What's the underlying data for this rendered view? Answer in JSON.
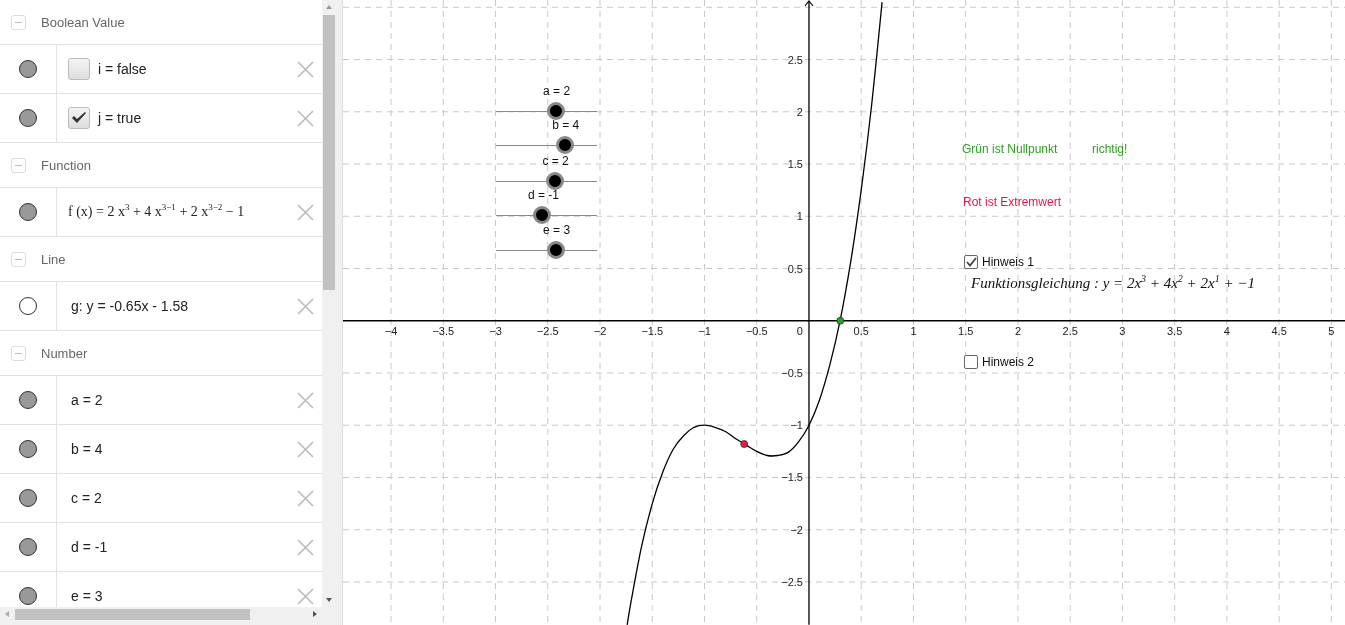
{
  "algebra": {
    "sections": [
      {
        "title": "Boolean Value",
        "expanded": true,
        "items": [
          {
            "kind": "boolean",
            "visible": true,
            "checked": false,
            "text": "i = false"
          },
          {
            "kind": "boolean",
            "visible": true,
            "checked": true,
            "text": "j = true"
          }
        ]
      },
      {
        "title": "Function",
        "expanded": true,
        "items": [
          {
            "kind": "formula",
            "visible": true,
            "text": "f (x) = 2 x$^{3}$ + 4 x$^{3−1}$ + 2 x$^{3−2}$ − 1"
          }
        ]
      },
      {
        "title": "Line",
        "expanded": true,
        "items": [
          {
            "kind": "value",
            "visible": false,
            "text": "g: y = -0.65x - 1.58"
          }
        ]
      },
      {
        "title": "Number",
        "expanded": true,
        "items": [
          {
            "kind": "value",
            "visible": true,
            "text": "a = 2"
          },
          {
            "kind": "value",
            "visible": true,
            "text": "b = 4"
          },
          {
            "kind": "value",
            "visible": true,
            "text": "c = 2"
          },
          {
            "kind": "value",
            "visible": true,
            "text": "d = -1"
          },
          {
            "kind": "value",
            "visible": true,
            "text": "e = 3"
          }
        ]
      }
    ]
  },
  "graphics": {
    "sliders": [
      {
        "label": "a = 2",
        "level": 0.59
      },
      {
        "label": "b = 4",
        "level": 0.68
      },
      {
        "label": "c = 2",
        "level": 0.58
      },
      {
        "label": "d = -1",
        "level": 0.46
      },
      {
        "label": "e = 3",
        "level": 0.59
      }
    ],
    "texts": [
      {
        "text": "Grün ist Nullpunkt",
        "color": "#2e9e22"
      },
      {
        "text": "richtig!",
        "color": "#2e9e22"
      },
      {
        "text": "Rot ist Extremwert",
        "color": "#e8164a"
      }
    ],
    "checkboxes": [
      {
        "label": "Hinweis 1",
        "checked": true
      },
      {
        "label": "Hinweis 2",
        "checked": false
      }
    ],
    "formula": "Funktionsgleichung : y = 2x$^{3}$ + 4x$^{2}$ + 2x$^{1}$ + −1",
    "origin_label": "0",
    "points": [
      {
        "color": "#2aa02a"
      },
      {
        "color": "#e8164a"
      }
    ],
    "chart_data": {
      "type": "line",
      "grid": true,
      "xlim": [
        -4.46,
        5.14
      ],
      "ylim": [
        -2.91,
        3.07
      ],
      "x": [
        -1.74,
        -1.7,
        -1.6,
        -1.5,
        -1.4,
        -1.3,
        -1.2,
        -1.1,
        -1.0,
        -0.9,
        -0.8,
        -0.7,
        -0.6,
        -0.5,
        -0.4,
        -0.3,
        -0.2,
        -0.1,
        0,
        0.1,
        0.2,
        0.3,
        0.4,
        0.5,
        0.6,
        0.7
      ],
      "series": [
        {
          "color": "#000000",
          "values": [
            -2.91,
            -2.67,
            -2.15,
            -1.75,
            -1.45,
            -1.23,
            -1.1,
            -1.02,
            -1,
            -1.02,
            -1.06,
            -1.13,
            -1.19,
            -1.25,
            -1.29,
            -1.29,
            -1.26,
            -1.16,
            -1,
            -0.76,
            -0.42,
            0.01,
            0.57,
            1.25,
            2.07,
            3.05
          ]
        }
      ],
      "xticks": [
        {
          "value": -4,
          "label": "−4"
        },
        {
          "value": -3.5,
          "label": "−3.5"
        },
        {
          "value": -3,
          "label": "−3"
        },
        {
          "value": -2.5,
          "label": "−2.5"
        },
        {
          "value": -2,
          "label": "−2"
        },
        {
          "value": -1.5,
          "label": "−1.5"
        },
        {
          "value": -1,
          "label": "−1"
        },
        {
          "value": -0.5,
          "label": "−0.5"
        },
        {
          "value": 0.5,
          "label": "0.5"
        },
        {
          "value": 1,
          "label": "1"
        },
        {
          "value": 1.5,
          "label": "1.5"
        },
        {
          "value": 2,
          "label": "2"
        },
        {
          "value": 2.5,
          "label": "2.5"
        },
        {
          "value": 3,
          "label": "3"
        },
        {
          "value": 3.5,
          "label": "3.5"
        },
        {
          "value": 4,
          "label": "4"
        },
        {
          "value": 4.5,
          "label": "4.5"
        },
        {
          "value": 5,
          "label": "5"
        }
      ],
      "yticks": [
        {
          "value": -2.5,
          "label": "−2.5"
        },
        {
          "value": -2,
          "label": "−2"
        },
        {
          "value": -1.5,
          "label": "−1.5"
        },
        {
          "value": -1,
          "label": "−1"
        },
        {
          "value": -0.5,
          "label": "−0.5"
        },
        {
          "value": 0.5,
          "label": "0.5"
        },
        {
          "value": 1,
          "label": "1"
        },
        {
          "value": 1.5,
          "label": "1.5"
        },
        {
          "value": 2,
          "label": "2"
        },
        {
          "value": 2.5,
          "label": "2.5"
        }
      ]
    }
  }
}
